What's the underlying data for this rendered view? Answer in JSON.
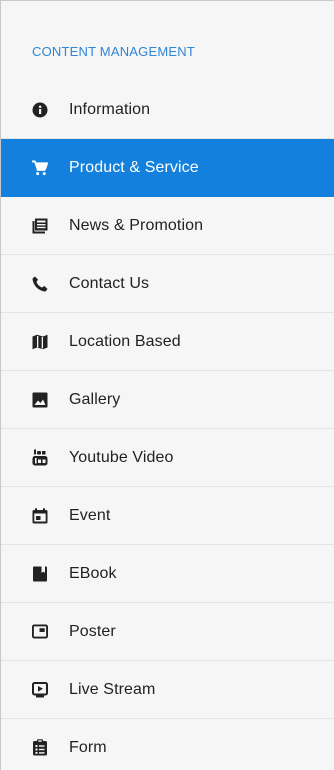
{
  "sidebar": {
    "section_title": "CONTENT MANAGEMENT",
    "items": [
      {
        "label": "Information",
        "icon": "info-circle-icon",
        "active": false
      },
      {
        "label": "Product & Service",
        "icon": "shopping-cart-icon",
        "active": true
      },
      {
        "label": "News & Promotion",
        "icon": "newspaper-icon",
        "active": false
      },
      {
        "label": "Contact Us",
        "icon": "phone-icon",
        "active": false
      },
      {
        "label": "Location Based",
        "icon": "map-icon",
        "active": false
      },
      {
        "label": "Gallery",
        "icon": "image-icon",
        "active": false
      },
      {
        "label": "Youtube Video",
        "icon": "youtube-icon",
        "active": false
      },
      {
        "label": "Event",
        "icon": "calendar-icon",
        "active": false
      },
      {
        "label": "EBook",
        "icon": "book-icon",
        "active": false
      },
      {
        "label": "Poster",
        "icon": "poster-icon",
        "active": false
      },
      {
        "label": "Live Stream",
        "icon": "live-stream-icon",
        "active": false
      },
      {
        "label": "Form",
        "icon": "clipboard-form-icon",
        "active": false
      }
    ]
  },
  "colors": {
    "accent": "#1280dc",
    "section_title": "#2f85d6",
    "background": "#f6f6f6",
    "text": "#222222"
  }
}
